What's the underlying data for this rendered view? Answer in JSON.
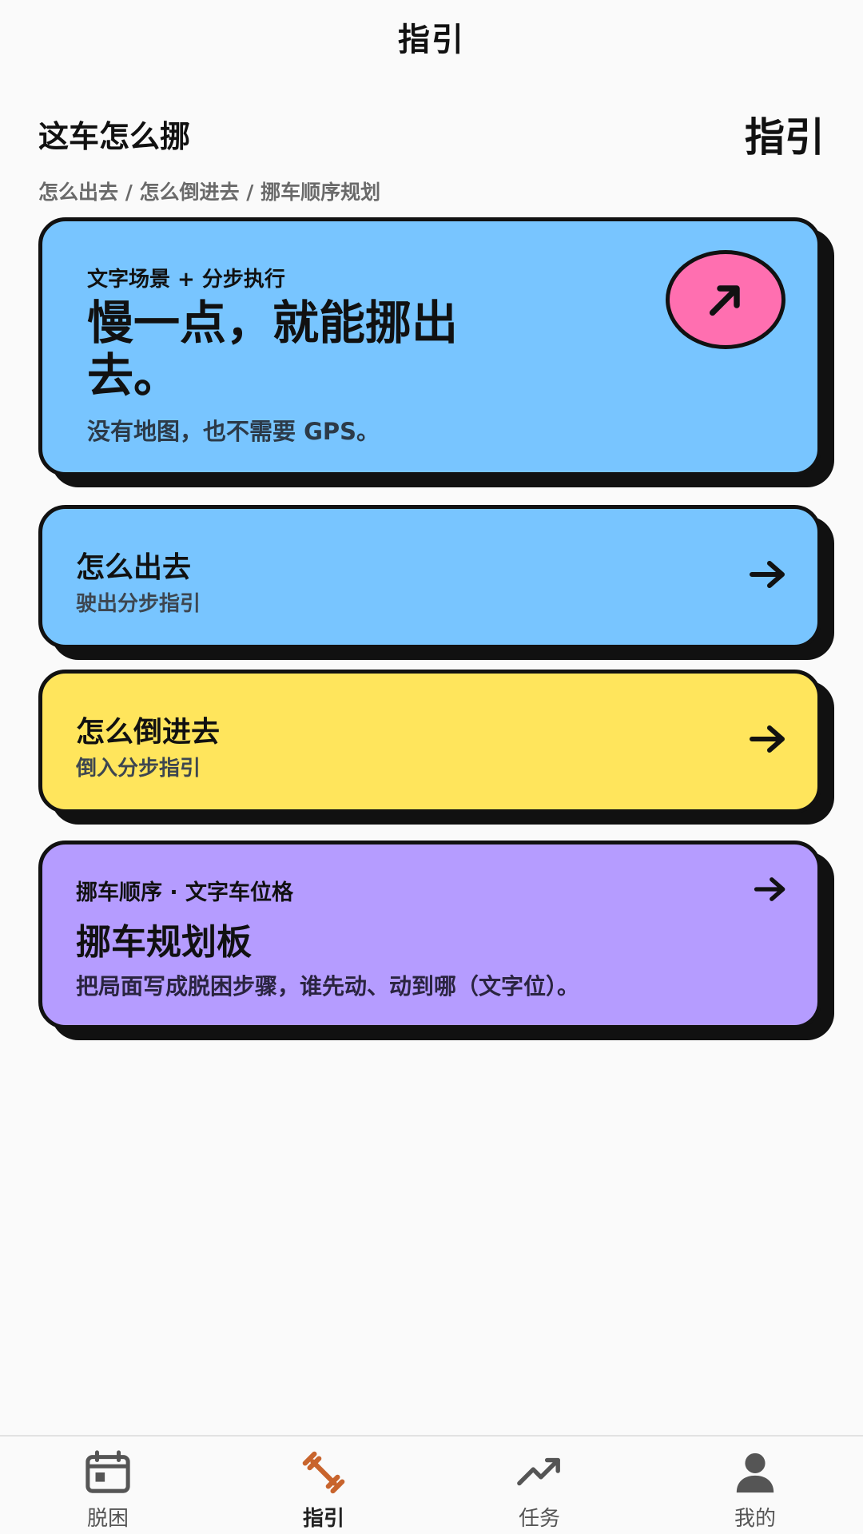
{
  "top_bar": {
    "title": "指引"
  },
  "header": {
    "title": "这车怎么挪",
    "right_label": "指引",
    "subtitle": "怎么出去 / 怎么倒进去 / 挪车顺序规划"
  },
  "hero_card": {
    "kicker": "文字场景 + 分步执行",
    "title": "慢一点，就能挪出去。",
    "subtitle": "没有地图，也不需要 GPS。",
    "badge_icon": "arrow-up-right-icon",
    "color": "#78c5ff",
    "badge_color": "#ff6fb0"
  },
  "cards": [
    {
      "title": "怎么出去",
      "subtitle": "驶出分步指引",
      "color": "#78c5ff",
      "icon": "arrow-right-icon"
    },
    {
      "title": "怎么倒进去",
      "subtitle": "倒入分步指引",
      "color": "#ffe55c",
      "icon": "arrow-right-icon"
    }
  ],
  "plan_card": {
    "kicker": "挪车顺序 · 文字车位格",
    "title": "挪车规划板",
    "subtitle": "把局面写成脱困步骤，谁先动、动到哪（文字位）。",
    "color": "#b59cff",
    "icon": "arrow-right-icon"
  },
  "bottom_nav": {
    "items": [
      {
        "label": "脱困",
        "icon": "calendar-icon",
        "active": false
      },
      {
        "label": "指引",
        "icon": "dumbbell-icon",
        "active": true
      },
      {
        "label": "任务",
        "icon": "trending-up-icon",
        "active": false
      },
      {
        "label": "我的",
        "icon": "person-icon",
        "active": false
      }
    ],
    "active_color": "#c8642d"
  }
}
